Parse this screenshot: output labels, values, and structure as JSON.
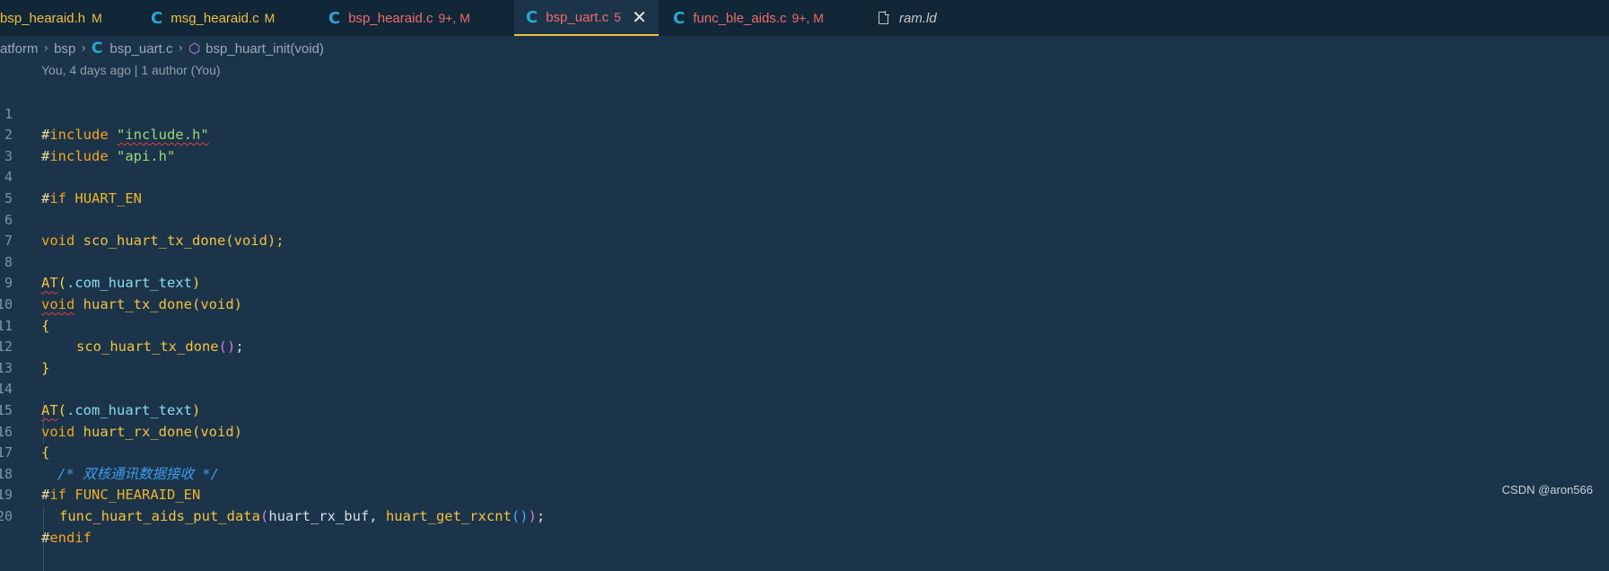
{
  "tabs": [
    {
      "name": "bsp_hearaid.h",
      "badge": "M"
    },
    {
      "name": "msg_hearaid.c",
      "badge": "M"
    },
    {
      "name": "bsp_hearaid.c",
      "badge": "9+, M"
    },
    {
      "name": "bsp_uart.c",
      "badge": "5",
      "active": true
    },
    {
      "name": "func_ble_aids.c",
      "badge": "9+, M"
    },
    {
      "name": "ram.ld",
      "badge": ""
    }
  ],
  "breadcrumb": {
    "items": [
      "atform",
      "bsp",
      "bsp_uart.c",
      "bsp_huart_init(void)"
    ]
  },
  "blame": "You, 4 days ago | 1 author (You)",
  "code": {
    "line_numbers": [
      "1",
      "2",
      "3",
      "4",
      "5",
      "6",
      "7",
      "8",
      "9",
      "10",
      "11",
      "12",
      "13",
      "14",
      "15",
      "16",
      "17",
      "18",
      "19",
      "20"
    ],
    "tokens": {
      "hash": "#",
      "include": "include",
      "include_h": "\"include.h\"",
      "api_h": "\"api.h\"",
      "if": "if",
      "huart_en": "HUART_EN",
      "void": "void",
      "sco_decl": "sco_huart_tx_done(void);",
      "at": "AT",
      "com_huart_text": ".com_huart_text",
      "huart_tx_done": "huart_tx_done",
      "void_param": "(void)",
      "open_brace": "{",
      "close_brace": "}",
      "sco_call": "sco_huart_tx_done",
      "call_parens": "()",
      "semicolon": ";",
      "huart_rx_done": "huart_rx_done",
      "comment": "/* 双核通讯数据接收 */",
      "func_hearaid_en": "FUNC_HEARAID_EN",
      "func_put": "func_huart_aids_put_data",
      "rx_buf": "huart_rx_buf, ",
      "get_rxcnt": "huart_get_rxcnt",
      "endif": "endif",
      "open_paren": "(",
      "close_paren": ")"
    }
  },
  "watermark": "CSDN @aron566",
  "colors": {
    "editor_bg": "#1b3449",
    "tabbar_bg": "#112738",
    "active_tab_border": "#f0c040",
    "c_icon": "#2aa6d6"
  }
}
